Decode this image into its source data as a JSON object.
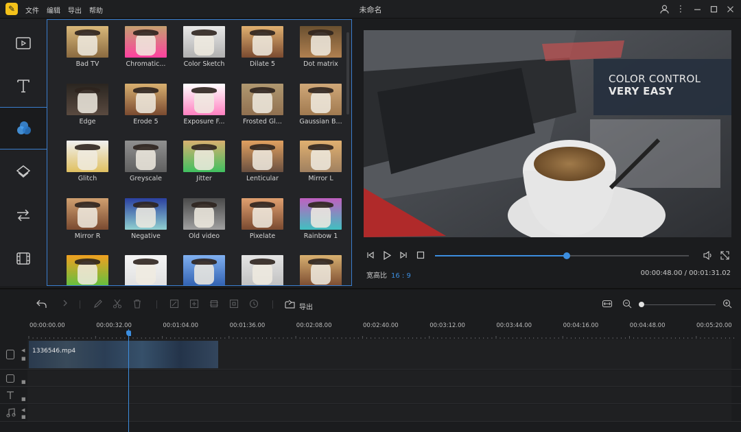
{
  "window": {
    "title": "未命名",
    "menu": [
      "文件",
      "编辑",
      "导出",
      "帮助"
    ]
  },
  "effects": [
    "Bad TV",
    "Chromatic...",
    "Color Sketch",
    "Dilate 5",
    "Dot matrix",
    "Edge",
    "Erode 5",
    "Exposure F...",
    "Frosted Gl...",
    "Gaussian B...",
    "Glitch",
    "Greyscale",
    "Jitter",
    "Lenticular",
    "Mirror L",
    "Mirror R",
    "Negative",
    "Old video",
    "Pixelate",
    "Rainbow 1",
    "",
    "",
    "",
    "",
    ""
  ],
  "preview": {
    "overlay_line1": "COLOR CONTROL",
    "overlay_line2": "VERY EASY",
    "ratio_label": "宽高比",
    "ratio_value": "16 : 9",
    "time": "00:00:48.00 / 00:01:31.02",
    "progress": 0.52
  },
  "timeline": {
    "export_label": "导出",
    "ticks": [
      "00:00:00.00",
      "00:00:32.00",
      "00:01:04.00",
      "00:01:36.00",
      "00:02:08.00",
      "00:02:40.00",
      "00:03:12.00",
      "00:03:44.00",
      "00:04:16.00",
      "00:04:48.00",
      "00:05:20.00"
    ],
    "clip_name": "1336546.mp4"
  },
  "colors": {
    "accent": "#3c8ee0"
  }
}
